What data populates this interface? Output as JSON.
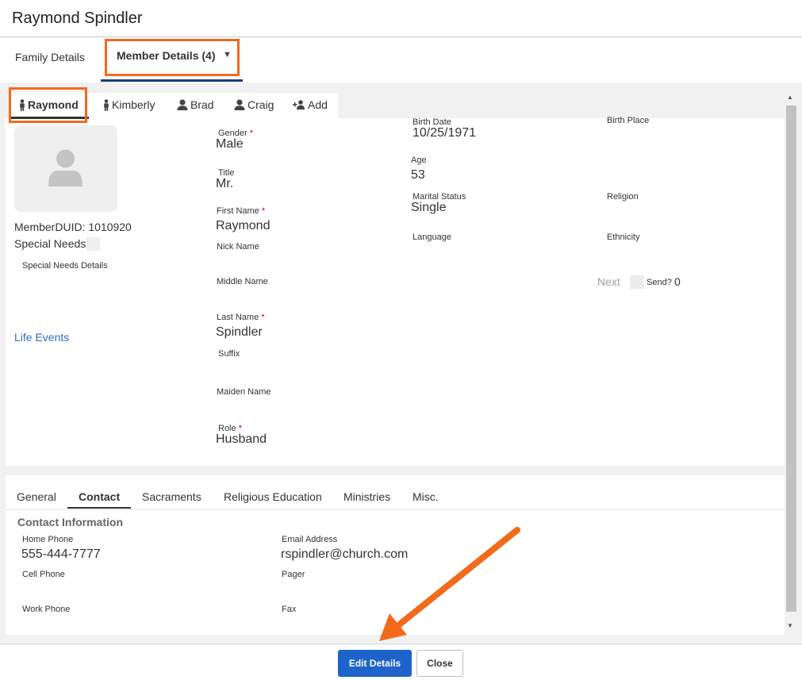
{
  "dialog": {
    "title": "Raymond Spindler"
  },
  "top_tabs": {
    "family": "Family Details",
    "member": "Member Details (4)",
    "member_caret": "▼"
  },
  "member_tabs": {
    "raymond": "Raymond",
    "kimberly": "Kimberly",
    "brad": "Brad",
    "craig": "Craig",
    "add": "Add"
  },
  "profile": {
    "member_duid": "MemberDUID: 1010920",
    "special_needs": "Special Needs",
    "special_needs_details": "Special Needs Details",
    "life_events": "Life Events"
  },
  "fields": {
    "gender": {
      "label": "Gender",
      "value": "Male"
    },
    "title": {
      "label": "Title",
      "value": "Mr."
    },
    "first_name": {
      "label": "First Name",
      "value": "Raymond"
    },
    "nick_name": {
      "label": "Nick Name",
      "value": ""
    },
    "middle_name": {
      "label": "Middle Name",
      "value": ""
    },
    "last_name": {
      "label": "Last Name",
      "value": "Spindler"
    },
    "suffix": {
      "label": "Suffix",
      "value": ""
    },
    "maiden_name": {
      "label": "Maiden Name",
      "value": ""
    },
    "role": {
      "label": "Role",
      "value": "Husband"
    },
    "birth_date": {
      "label": "Birth Date",
      "value": "10/25/1971"
    },
    "age": {
      "label": "Age",
      "value": "53"
    },
    "marital_status": {
      "label": "Marital Status",
      "value": "Single"
    },
    "language": {
      "label": "Language",
      "value": ""
    },
    "birth_place": {
      "label": "Birth Place",
      "value": ""
    },
    "religion": {
      "label": "Religion",
      "value": ""
    },
    "ethnicity": {
      "label": "Ethnicity",
      "value": ""
    },
    "required_mark": "*"
  },
  "next_send": {
    "next": "Next",
    "send": "Send?",
    "count": "0"
  },
  "bottom_tabs": {
    "general": "General",
    "contact": "Contact",
    "sacraments": "Sacraments",
    "religious_education": "Religious Education",
    "ministries": "Ministries",
    "misc": "Misc."
  },
  "contact": {
    "heading": "Contact Information",
    "home_phone": {
      "label": "Home Phone",
      "value": "555-444-7777"
    },
    "cell_phone": {
      "label": "Cell Phone",
      "value": ""
    },
    "work_phone": {
      "label": "Work Phone",
      "value": ""
    },
    "email": {
      "label": "Email Address",
      "value": "rspindler@church.com"
    },
    "pager": {
      "label": "Pager",
      "value": ""
    },
    "fax": {
      "label": "Fax",
      "value": ""
    }
  },
  "footer": {
    "edit": "Edit Details",
    "close": "Close"
  },
  "colors": {
    "accent": "#1d63c9",
    "highlight": "#f26a1b",
    "link": "#2d6fc0",
    "required": "#d0021b"
  },
  "scroll": {
    "up_icon": "▲",
    "down_icon": "▼"
  }
}
